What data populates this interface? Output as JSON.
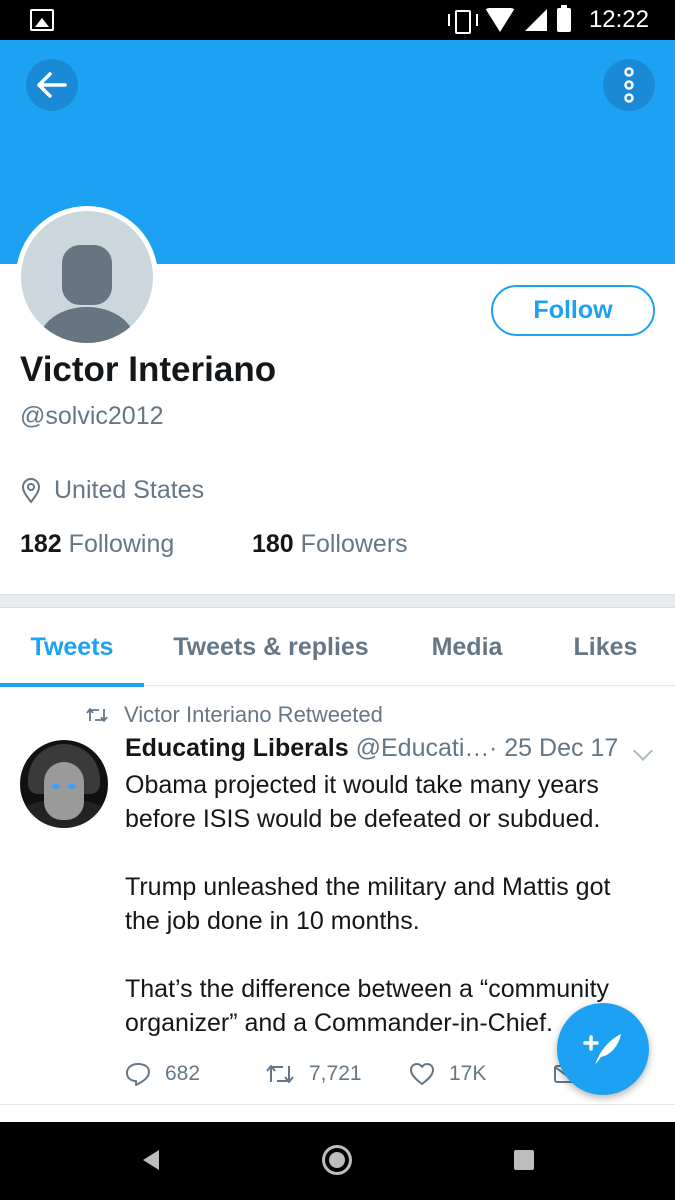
{
  "status_bar": {
    "time": "12:22"
  },
  "profile": {
    "name": "Victor Interiano",
    "handle": "@solvic2012",
    "location": "United States",
    "following_count": "182",
    "following_label": "Following",
    "followers_count": "180",
    "followers_label": "Followers",
    "follow_button": "Follow"
  },
  "tabs": [
    {
      "label": "Tweets",
      "active": true
    },
    {
      "label": "Tweets & replies",
      "active": false
    },
    {
      "label": "Media",
      "active": false
    },
    {
      "label": "Likes",
      "active": false
    }
  ],
  "tweet": {
    "retweeted_by": "Victor Interiano Retweeted",
    "author": "Educating Liberals",
    "handle": "@Educati…",
    "date": "· 25 Dec 17",
    "paragraphs": [
      "Obama projected it would take many years\nbefore ISIS would be defeated or subdued.",
      "Trump unleashed the military and Mattis got\nthe job done in 10 months.",
      "That’s the difference between a “community\norganizer” and a Commander-in-Chief."
    ],
    "replies": "682",
    "retweets": "7,721",
    "likes": "17K"
  },
  "colors": {
    "brand": "#1da1f2",
    "secondary_text": "#657786",
    "primary_text": "#14171a"
  },
  "icons": [
    "image-icon",
    "vibrate-icon",
    "wifi-icon",
    "signal-icon",
    "battery-icon",
    "back-arrow-icon",
    "more-options-icon",
    "location-pin-icon",
    "retweet-icon",
    "reply-icon",
    "like-icon",
    "message-icon",
    "compose-icon",
    "chevron-down-icon"
  ]
}
